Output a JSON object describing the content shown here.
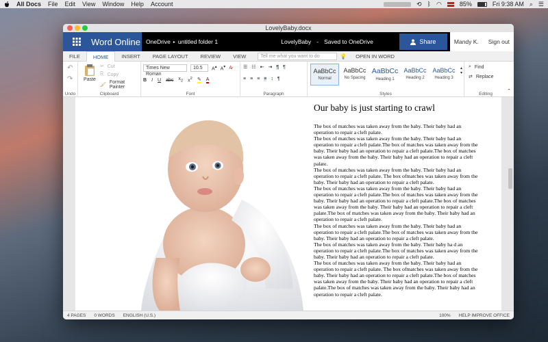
{
  "menubar": {
    "app": "All Docs",
    "items": [
      "File",
      "Edit",
      "View",
      "Window",
      "Help",
      "Account"
    ],
    "battery": "85%",
    "clock": "Fri 9:38 AM"
  },
  "window": {
    "title": "LovelyBaby.docx"
  },
  "appbar": {
    "brand": "Word Online",
    "breadcrumb_root": "OneDrive",
    "breadcrumb_folder": "untitled folder 1",
    "doc_name": "LovelyBaby",
    "separator": "-",
    "save_status": "Saved to OneDrive",
    "share_label": "Share",
    "user_name": "Mandy K.",
    "signout_label": "Sign out"
  },
  "tabs": {
    "items": [
      "FILE",
      "HOME",
      "INSERT",
      "PAGE LAYOUT",
      "REVIEW",
      "VIEW"
    ],
    "tellme_placeholder": "Tell me what you want to do",
    "open_in_word": "OPEN IN WORD"
  },
  "ribbon": {
    "undo_label": "Undo",
    "paste_label": "Paste",
    "cut_label": "Cut",
    "copy_label": "Copy",
    "format_painter_label": "Format Painter",
    "clipboard_label": "Clipboard",
    "font_name": "Times New Roman",
    "font_size": "10.5",
    "font_label": "Font",
    "paragraph_label": "Paragraph",
    "styles": [
      {
        "preview": "AaBbCc",
        "name": "Normal"
      },
      {
        "preview": "AaBbCc",
        "name": "No Spacing"
      },
      {
        "preview": "AaBbCc",
        "name": "Heading 1"
      },
      {
        "preview": "AaBbCc",
        "name": "Heading 2"
      },
      {
        "preview": "AaBbCc",
        "name": "Heading 3"
      }
    ],
    "styles_label": "Styles",
    "find_label": "Find",
    "replace_label": "Replace",
    "editing_label": "Editing"
  },
  "document": {
    "title": "Our baby is just starting to crawl",
    "paragraphs": [
      "The box of  matches was taken away from the baby. Their baby had an operation to repair a cleft palate.",
      "The box of matches was taken away from the baby. Their baby had an operation to repair a cleft palate.The box of matches was taken away from the baby. Their baby had an operation to repair a cleft palate.The box of matches was taken away from the baby. Their baby had an operation to repair a cleft palate.",
      "The box of matches was taken away from the baby. Their baby had an operation to repair a cleft palate. The box ofmatches was taken away from the baby. Their baby had an operation to repair a cleft palate.",
      "The box of matches was taken away from the baby. Their baby had an operation to repair a cleft palate.The box of matches was taken away from the baby. Their baby had an operation to repair a cleft palate.The box of matches was taken away from the baby. Their baby had an operation to repair a cleft palate.The box of matches was taken away from the baby. Their baby had an operation to repair a cleft palate.",
      "The box of  matches was taken away from the baby. Their baby had an operation to repair a cleft palate.The box of matches was taken away from the baby. Their baby had an operation to repair a cleft palate.",
      "The box of matches was taken away from the baby. Their baby ha   d an operation to repair a cleft palate.The box of matches was taken away from the baby. Their baby had an operation to repair a cleft palate.",
      "The box of matches was taken away from the baby. Their baby had an operation to repair a cleft palate. The box ofmatches was taken away from the baby. Their baby had an operation to repair a cleft palate.The box of matches was taken away from the baby. Their baby had an operation to repair a cleft palate.The box of matches was taken away from the baby. Their baby had an operation to repair a cleft palate."
    ]
  },
  "statusbar": {
    "pages": "4 PAGES",
    "words": "0 WORDS",
    "language": "ENGLISH (U.S.)",
    "zoom": "100%",
    "help": "HELP IMPROVE OFFICE"
  },
  "colors": {
    "accent": "#2b579a",
    "appbar_bg": "#000000"
  }
}
